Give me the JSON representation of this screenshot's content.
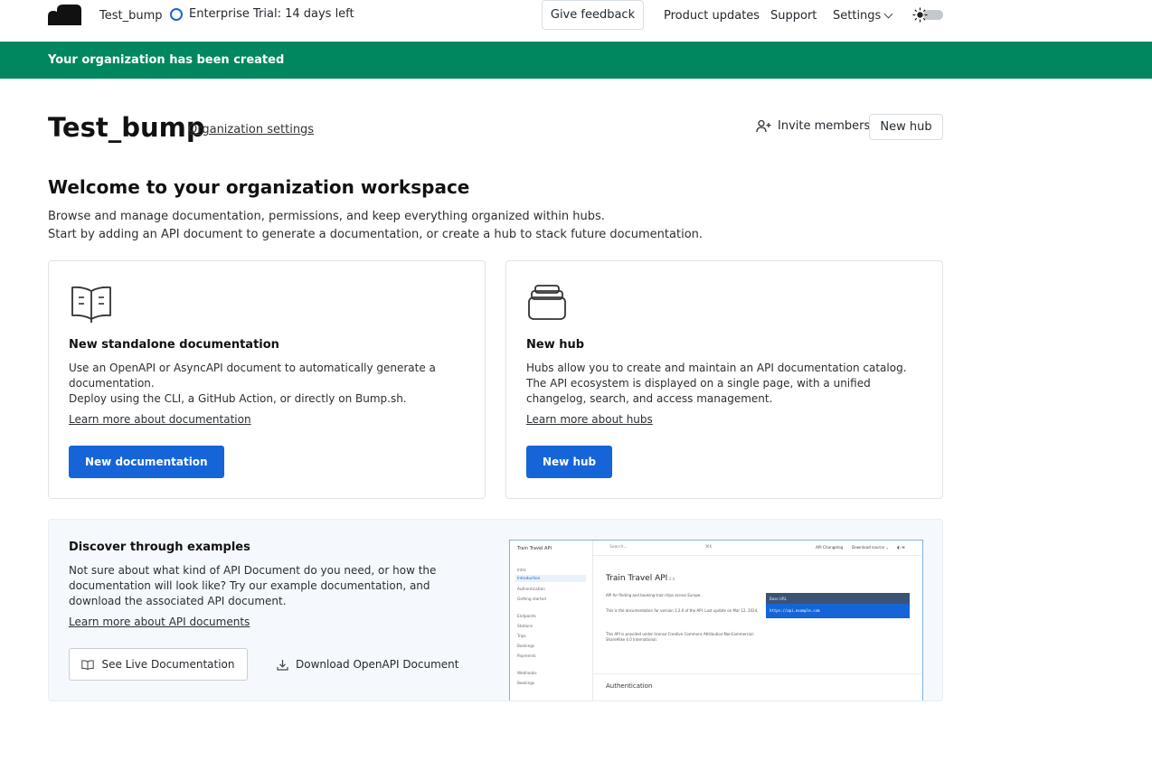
{
  "nav": {
    "org_name": "Test_bump",
    "trial": "Enterprise Trial: 14 days left",
    "feedback": "Give feedback",
    "product_updates": "Product updates",
    "support": "Support",
    "settings": "Settings"
  },
  "banner": "Your organization has been created",
  "header": {
    "title": "Test_bump",
    "org_settings": "Organization settings",
    "invite": "Invite members",
    "new_hub": "New hub"
  },
  "welcome": {
    "title": "Welcome to your organization workspace",
    "line1": "Browse and manage documentation, permissions, and keep everything organized within hubs.",
    "line2": "Start by adding an API document to generate a documentation, or create a hub to stack future documentation."
  },
  "cards": {
    "doc": {
      "title": "New standalone documentation",
      "desc1": "Use an OpenAPI or AsyncAPI document to automatically generate a documentation.",
      "desc2": "Deploy using the CLI, a GitHub Action, or directly on Bump.sh.",
      "link": "Learn more about documentation",
      "button": "New documentation"
    },
    "hub": {
      "title": "New hub",
      "desc1": "Hubs allow you to create and maintain an API documentation catalog.",
      "desc2": "The API ecosystem is displayed on a single page, with a unified changelog, search, and access management.",
      "link": "Learn more about hubs",
      "button": "New hub"
    }
  },
  "examples": {
    "title": "Discover through examples",
    "desc": "Not sure about what kind of API Document do you need, or how the documentation will look like? Try our example documentation, and download the associated API document.",
    "link": "Learn more about API documents",
    "live_button": "See Live Documentation",
    "download_button": "Download OpenAPI Document"
  },
  "preview": {
    "brand": "Train Travel API",
    "sidebar": [
      "Intro",
      "Introduction",
      "Authentication",
      "Getting started",
      "Endpoints",
      "Stations",
      "Trips",
      "Bookings",
      "Payments",
      "Webhooks",
      "Bookings"
    ],
    "search": "Search...",
    "kbd": "⌘K",
    "changelog": "API Changelog",
    "download": "Download source ⌄",
    "toggle": "◐ ☰",
    "h1": "Train Travel API",
    "version": "1.2.0",
    "p1": "API for finding and booking train trips across Europe.",
    "p2": "This is the documentation for version 1.2.0 of the API. Last update on Mar 12, 2024.",
    "p3": "This API is provided under license Creative Commons Attribution-NonCommercial-ShareAlike 4.0 International.",
    "code_header": "Base URL",
    "code_body": "https://api.example.com",
    "h2": "Authentication"
  },
  "colors": {
    "banner": "#00875f",
    "primary": "#1565d8",
    "trial_circle": "#1b66c9"
  }
}
